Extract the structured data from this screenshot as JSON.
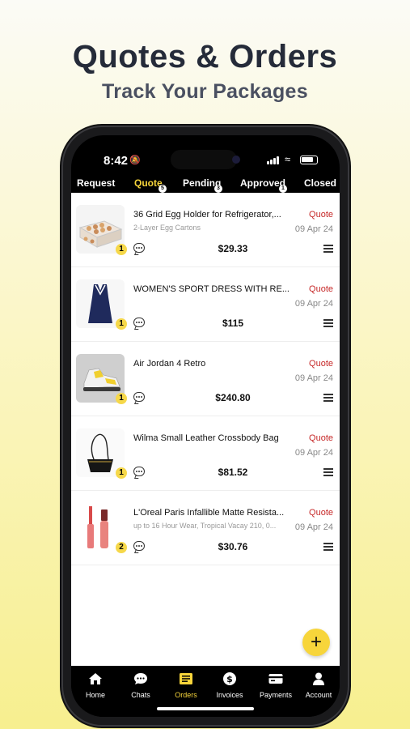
{
  "hero": {
    "title": "Quotes & Orders",
    "subtitle": "Track Your Packages"
  },
  "status_bar": {
    "time": "8:42"
  },
  "tabs": [
    {
      "label": "Request",
      "badge": ""
    },
    {
      "label": "Quote",
      "badge": "5"
    },
    {
      "label": "Pending",
      "badge": "3"
    },
    {
      "label": "Approved",
      "badge": "1"
    },
    {
      "label": "Closed",
      "badge": ""
    }
  ],
  "active_tab": "Quote",
  "items": [
    {
      "name": "36 Grid Egg Holder for Refrigerator,...",
      "subtitle": "2-Layer Egg Cartons",
      "quantity": "1",
      "price": "$29.33",
      "status": "Quote",
      "date": "09 Apr 24",
      "image": "egg-holder-image"
    },
    {
      "name": "WOMEN'S SPORT DRESS WITH RE...",
      "subtitle": "",
      "quantity": "1",
      "price": "$115",
      "status": "Quote",
      "date": "09 Apr 24",
      "image": "sport-dress-image"
    },
    {
      "name": "Air Jordan 4 Retro",
      "subtitle": "",
      "quantity": "1",
      "price": "$240.80",
      "status": "Quote",
      "date": "09 Apr 24",
      "image": "sneaker-image"
    },
    {
      "name": "Wilma Small Leather Crossbody Bag",
      "subtitle": "",
      "quantity": "1",
      "price": "$81.52",
      "status": "Quote",
      "date": "09 Apr 24",
      "image": "crossbody-bag-image"
    },
    {
      "name": "L'Oreal Paris Infallible Matte Resista...",
      "subtitle": "up to 16 Hour Wear, Tropical Vacay 210, 0...",
      "quantity": "2",
      "price": "$30.76",
      "status": "Quote",
      "date": "09 Apr 24",
      "image": "lip-gloss-image"
    }
  ],
  "fab": {
    "icon": "plus-icon",
    "symbol": "+"
  },
  "nav": [
    {
      "label": "Home",
      "icon": "home-icon"
    },
    {
      "label": "Chats",
      "icon": "chat-bubble-icon"
    },
    {
      "label": "Orders",
      "icon": "orders-icon"
    },
    {
      "label": "Invoices",
      "icon": "dollar-coin-icon"
    },
    {
      "label": "Payments",
      "icon": "credit-card-icon"
    },
    {
      "label": "Account",
      "icon": "person-icon"
    }
  ],
  "active_nav": "Orders",
  "colors": {
    "accent": "#f7d53b",
    "status": "#c62828",
    "background": "#fbf6c6",
    "text": "#252b39"
  }
}
